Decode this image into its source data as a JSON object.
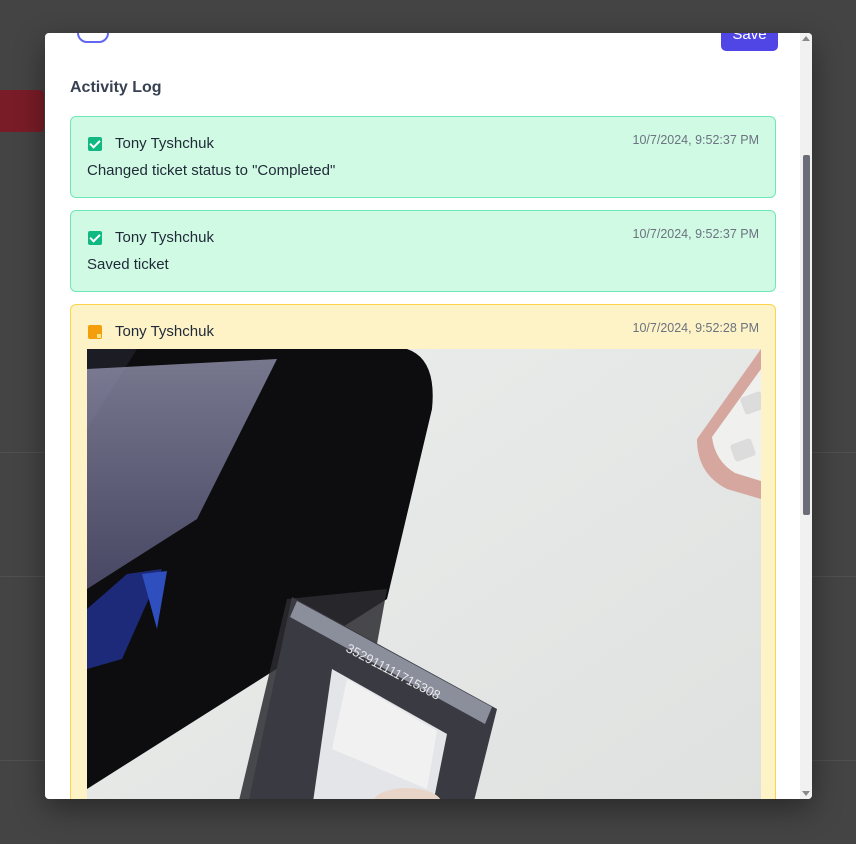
{
  "modal": {
    "save_label": "Save",
    "section_title": "Activity Log"
  },
  "activity_log": [
    {
      "type": "status",
      "author": "Tony Tyshchuk",
      "timestamp": "10/7/2024, 9:52:37 PM",
      "message": "Changed ticket status to \"Completed\"",
      "icon": "check-square-icon",
      "color": "#d1fae5"
    },
    {
      "type": "status",
      "author": "Tony Tyshchuk",
      "timestamp": "10/7/2024, 9:52:37 PM",
      "message": "Saved ticket",
      "icon": "check-square-icon",
      "color": "#d1fae5"
    },
    {
      "type": "note",
      "author": "Tony Tyshchuk",
      "timestamp": "10/7/2024, 9:52:28 PM",
      "icon": "sticky-note-icon",
      "color": "#fef3c7",
      "attachment": {
        "kind": "photo",
        "engraved_text": "352911111715308"
      }
    }
  ],
  "colors": {
    "accent": "#4f46e5",
    "success_bg": "#d1fae5",
    "note_bg": "#fef3c7"
  }
}
